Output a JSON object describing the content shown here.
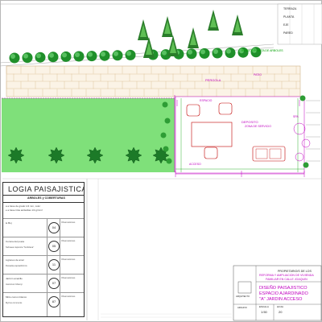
{
  "legend": {
    "title": "LOGIA PAISAJISTICA",
    "subtitle": "ARBOLES y COBERTURAS",
    "intro_1": "a a base de grado 1/4 mm, color",
    "intro_2": "e a base tinta antitetilas 1/4 gr/cm²",
    "rows": [
      {
        "label_1": "le Boj",
        "label_2": "",
        "code": "04"
      },
      {
        "label_1": "Corona del poeta",
        "label_2": "Subvaea Japonica \"Smilclana\"",
        "code": "05"
      },
      {
        "label_1": "Ligtones de amor",
        "label_2": "Russelia equisetiformis",
        "code": "11"
      },
      {
        "label_1": "Jazmin amarillo",
        "label_2": "Jasminum Mesnyi",
        "code": "07"
      },
      {
        "label_1": "Mirto comun blanco",
        "label_2": "Myrtus communis",
        "code": "87"
      }
    ]
  },
  "plan": {
    "label_depo": "DEPOSITO",
    "label_ducha": "DUCHA",
    "label_text_a": "PERGOLA",
    "label_text_b": "ESPACIO",
    "label_text_c": "DEPOSITO",
    "label_text_d": "ZONA DE SERVICIO",
    "label_spa": "SPA",
    "label_patio": "PATIO",
    "label_sub": "ACCESO",
    "top_right_1": "TERRAZA",
    "top_right_2": "PLANTA",
    "top_right_3": "EJE",
    "top_right_4": "PARED",
    "label_elev": "REMATE PLANTA DE ARBOLES"
  },
  "titleblock": {
    "owner": "PROPIETARIO/S DE LOS",
    "project_1": "REFORMA Y AMPLIACION DE VIVIENDA",
    "project_2": "FAMILIAR EN CALLE JOAQUIN",
    "address": "",
    "sheet_title_1": "DISEÑO PAISAJISTICO",
    "sheet_title_2": "ESPACIO AJARDINADO",
    "sheet_title_3": "\"A\" JARDIN ACCESO",
    "scale_label": "ESCALA",
    "sheet_label": "HOJA",
    "sheet_no": "20",
    "scale_value": "1:50",
    "archive_1": "ARQUITECTO",
    "archive_2": "ARCHIVO",
    "left_code": "Observaciones"
  },
  "colors": {
    "lawn": "#7fe07a",
    "tree": "#1f8f2a",
    "hatch": "#d9b98a",
    "magenta": "#c000c0",
    "green_text": "#00a000"
  }
}
